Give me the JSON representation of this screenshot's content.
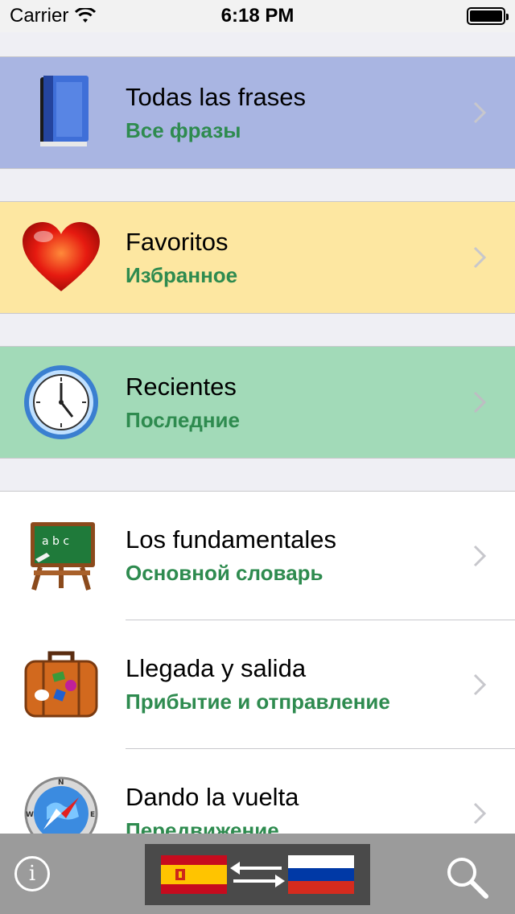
{
  "status_bar": {
    "carrier": "Carrier",
    "time": "6:18 PM"
  },
  "menu": {
    "items": [
      {
        "title": "Todas las frases",
        "subtitle": "Все фразы",
        "icon": "book-icon",
        "bg": "#a9b5e2"
      },
      {
        "title": "Favoritos",
        "subtitle": "Избранное",
        "icon": "heart-icon",
        "bg": "#fde7a1"
      },
      {
        "title": "Recientes",
        "subtitle": "Последние",
        "icon": "clock-icon",
        "bg": "#a2dab8"
      },
      {
        "title": "Los fundamentales",
        "subtitle": "Основной словарь",
        "icon": "chalkboard-icon",
        "bg": "#ffffff"
      },
      {
        "title": "Llegada y salida",
        "subtitle": "Прибытие и отправление",
        "icon": "suitcase-icon",
        "bg": "#ffffff"
      },
      {
        "title": "Dando la vuelta",
        "subtitle": "Передвижение",
        "icon": "compass-icon",
        "bg": "#ffffff"
      }
    ]
  },
  "toolbar": {
    "info_label": "i",
    "source_language_flag": "spain-flag-icon",
    "target_language_flag": "russia-flag-icon"
  },
  "colors": {
    "subtitle_green": "#2e8b4f",
    "toolbar_gray": "#9b9b9b"
  }
}
